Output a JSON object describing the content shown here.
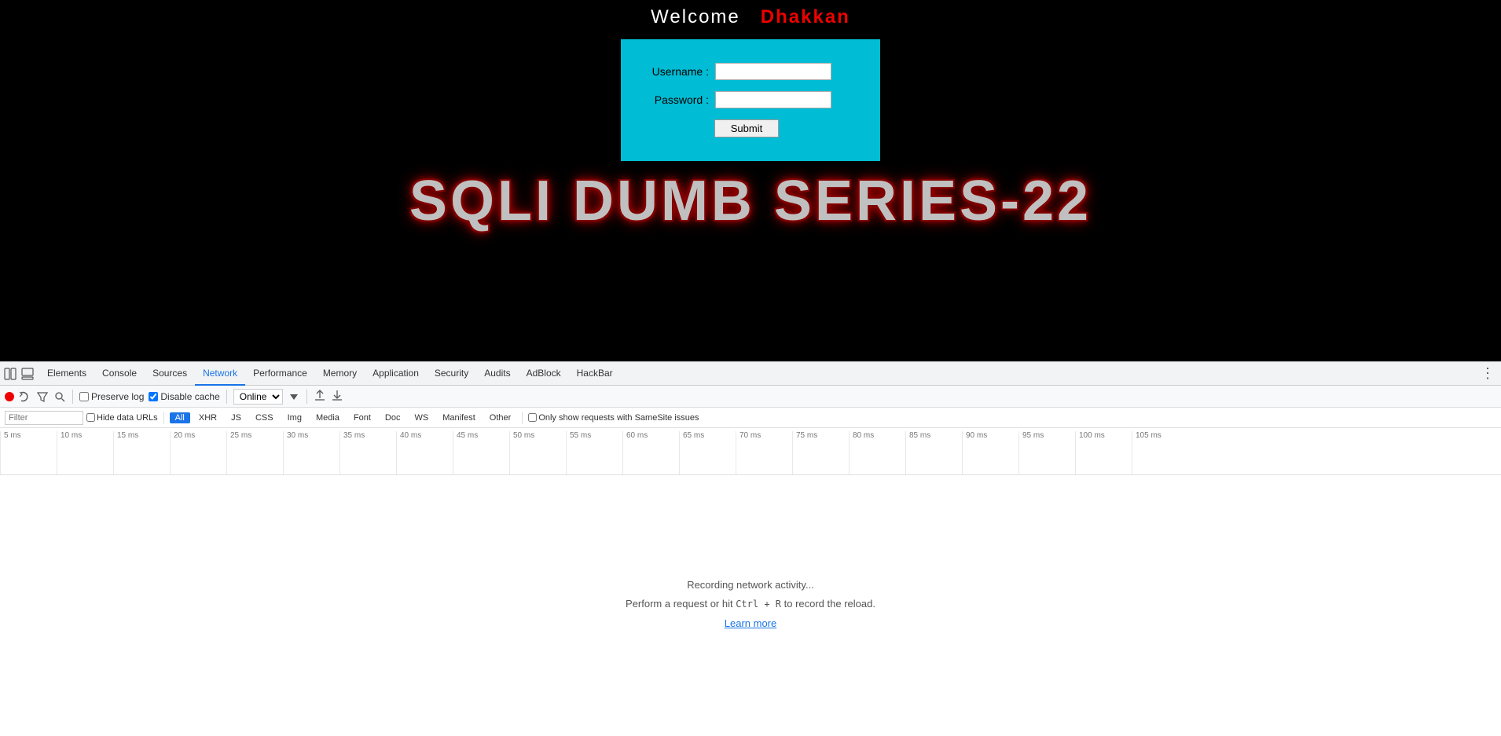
{
  "page": {
    "header": {
      "welcome": "Welcome",
      "dhakkan": "Dhakkan"
    },
    "login": {
      "username_label": "Username :",
      "password_label": "Password :",
      "submit_label": "Submit"
    },
    "title": "SQLI DUMB SERIES-22"
  },
  "devtools": {
    "tabs": [
      {
        "label": "Elements",
        "active": false
      },
      {
        "label": "Console",
        "active": false
      },
      {
        "label": "Sources",
        "active": false
      },
      {
        "label": "Network",
        "active": true
      },
      {
        "label": "Performance",
        "active": false
      },
      {
        "label": "Memory",
        "active": false
      },
      {
        "label": "Application",
        "active": false
      },
      {
        "label": "Security",
        "active": false
      },
      {
        "label": "Audits",
        "active": false
      },
      {
        "label": "AdBlock",
        "active": false
      },
      {
        "label": "HackBar",
        "active": false
      }
    ],
    "toolbar": {
      "preserve_log_label": "Preserve log",
      "disable_cache_label": "Disable cache",
      "online_label": "Online"
    },
    "filter": {
      "placeholder": "Filter",
      "hide_data_urls_label": "Hide data URLs",
      "types": [
        "All",
        "XHR",
        "JS",
        "CSS",
        "Img",
        "Media",
        "Font",
        "Doc",
        "WS",
        "Manifest",
        "Other"
      ],
      "active_type": "All",
      "samesite_label": "Only show requests with SameSite issues"
    },
    "timeline": {
      "ticks": [
        "5 ms",
        "10 ms",
        "15 ms",
        "20 ms",
        "25 ms",
        "30 ms",
        "35 ms",
        "40 ms",
        "45 ms",
        "50 ms",
        "55 ms",
        "60 ms",
        "65 ms",
        "70 ms",
        "75 ms",
        "80 ms",
        "85 ms",
        "90 ms",
        "95 ms",
        "100 ms",
        "105 ms"
      ]
    },
    "recording": {
      "main_text": "Recording network activity...",
      "sub_text": "Perform a request or hit ",
      "shortcut": "Ctrl + R",
      "sub_text2": " to record the reload.",
      "learn_more": "Learn more"
    }
  }
}
